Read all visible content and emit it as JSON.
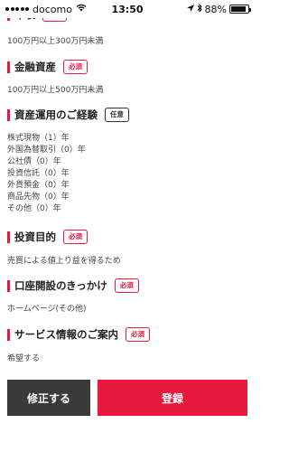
{
  "status_bar": {
    "carrier": "docomo",
    "time": "13:50",
    "battery": "88%",
    "battery_level": 0.88
  },
  "sections": {
    "annual_income": {
      "title": "年収",
      "badge": "必須",
      "value": "100万円以上300万円未満"
    },
    "financial_assets": {
      "title": "金融資産",
      "badge": "必須",
      "value": "100万円以上500万円未満"
    },
    "experience": {
      "title": "資産運用のご経験",
      "badge": "任意",
      "items": [
        "株式現物（1）年",
        "外国為替取引（0）年",
        "公社債（0）年",
        "投資信託（0）年",
        "外貨預金（0）年",
        "商品先物（0）年",
        "その他（0）年"
      ]
    },
    "purpose": {
      "title": "投資目的",
      "badge": "必須",
      "value": "売買による値上り益を得るため"
    },
    "trigger": {
      "title": "口座開設のきっかけ",
      "badge": "必須",
      "value": "ホームページ(その他)"
    },
    "service": {
      "title": "サービス情報のご案内",
      "badge": "必須",
      "value": "希望する"
    }
  },
  "buttons": {
    "edit": "修正する",
    "submit": "登録"
  },
  "colors": {
    "accent": "#e8193c",
    "dark_button": "#3a3a3a"
  }
}
